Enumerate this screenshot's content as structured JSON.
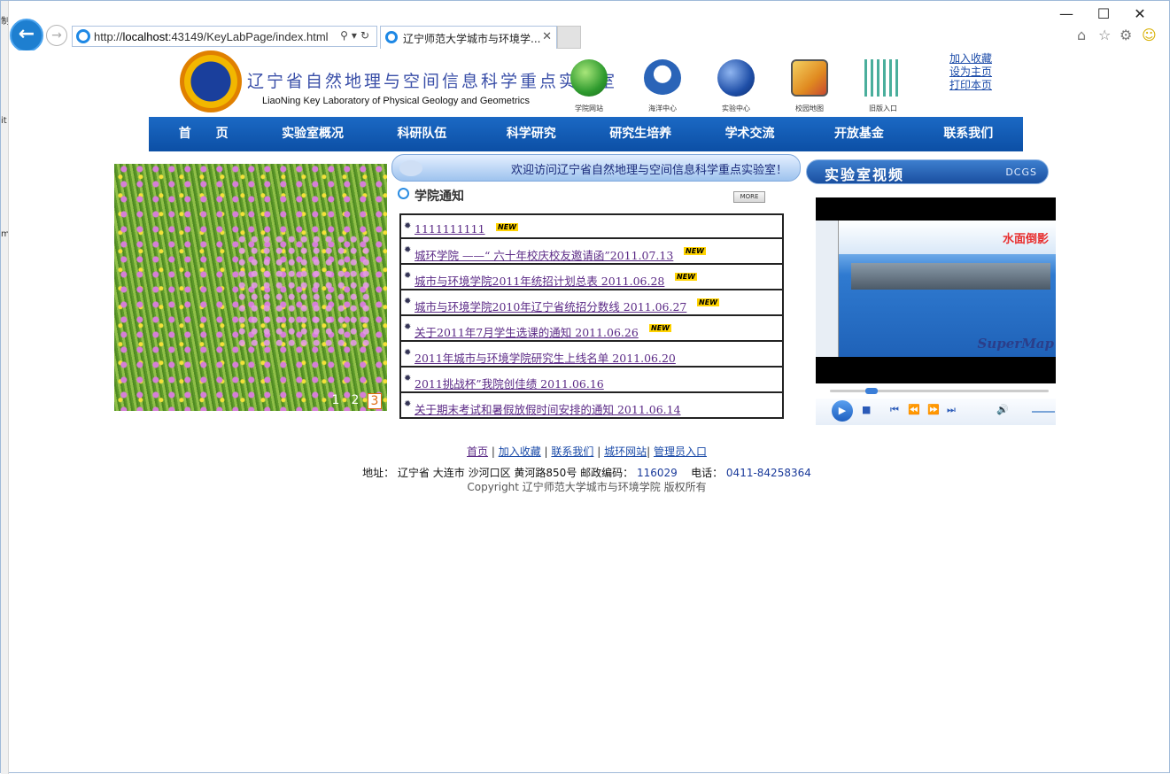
{
  "browser": {
    "url_prefix": "http://",
    "url_host": "localhost",
    "url_rest": ":43149/KeyLabPage/index.html",
    "tab_title": "辽宁师范大学城市与环境学...",
    "left_strip": [
      "制",
      "it",
      "m"
    ]
  },
  "header": {
    "title_cn": "辽宁省自然地理与空间信息科学重点实验室",
    "title_en": "LiaoNing Key Laboratory of Physical Geology and Geometrics",
    "quick_links": [
      {
        "label": "学院网站",
        "icon": "globe-icon",
        "color": "#2e9a2e"
      },
      {
        "label": "海洋中心",
        "icon": "ocean-icon",
        "color": "#2a64b8"
      },
      {
        "label": "实验中心",
        "icon": "lab-icon",
        "color": "#1f4fa8"
      },
      {
        "label": "校园地图",
        "icon": "map-icon",
        "color": "#c8a020"
      },
      {
        "label": "旧版入口",
        "icon": "old-entry-icon",
        "color": "#2aa08a"
      }
    ],
    "top_links": [
      "加入收藏",
      "设为主页",
      "打印本页"
    ]
  },
  "menu": [
    "首　　页",
    "实验室概况",
    "科研队伍",
    "科学研究",
    "研究生培养",
    "学术交流",
    "开放基金",
    "联系我们"
  ],
  "slideshow": {
    "pages": [
      "1",
      "2",
      "3"
    ],
    "active": "3"
  },
  "welcome": "欢迎访问辽宁省自然地理与空间信息科学重点实验室！",
  "notice": {
    "title": "学院通知",
    "more": "MORE",
    "new_badge": "NEW",
    "items": [
      {
        "text": "1111111111",
        "new": true
      },
      {
        "text": "城环学院 ——“ 六十年校庆校友邀请函”2011.07.13",
        "new": true
      },
      {
        "text": "城市与环境学院2011年统招计划总表 2011.06.28",
        "new": true
      },
      {
        "text": "城市与环境学院2010年辽宁省统招分数线 2011.06.27",
        "new": true
      },
      {
        "text": "关于2011年7月学生选课的通知 2011.06.26",
        "new": true
      },
      {
        "text": "2011年城市与环境学院研究生上线名单 2011.06.20",
        "new": false
      },
      {
        "text": "2011挑战杯”我院创佳绩 2011.06.16",
        "new": false
      },
      {
        "text": "关于期末考试和暑假放假时间安排的通知 2011.06.14",
        "new": false
      }
    ]
  },
  "video": {
    "title": "实验室视频",
    "tag": "DCGS",
    "overlay_label": "水面倒影",
    "watermark": "SuperMap"
  },
  "footer": {
    "links": [
      "首页",
      "加入收藏",
      "联系我们",
      "城环网站",
      "管理员入口"
    ],
    "address_label": "地址：",
    "address": "辽宁省 大连市 沙河口区 黄河路850号",
    "postcode_label": "邮政编码：",
    "postcode": "116029",
    "phone_label": "电话：",
    "phone": "0411-84258364",
    "copyright": "Copyright 辽宁师范大学城市与环境学院 版权所有"
  }
}
